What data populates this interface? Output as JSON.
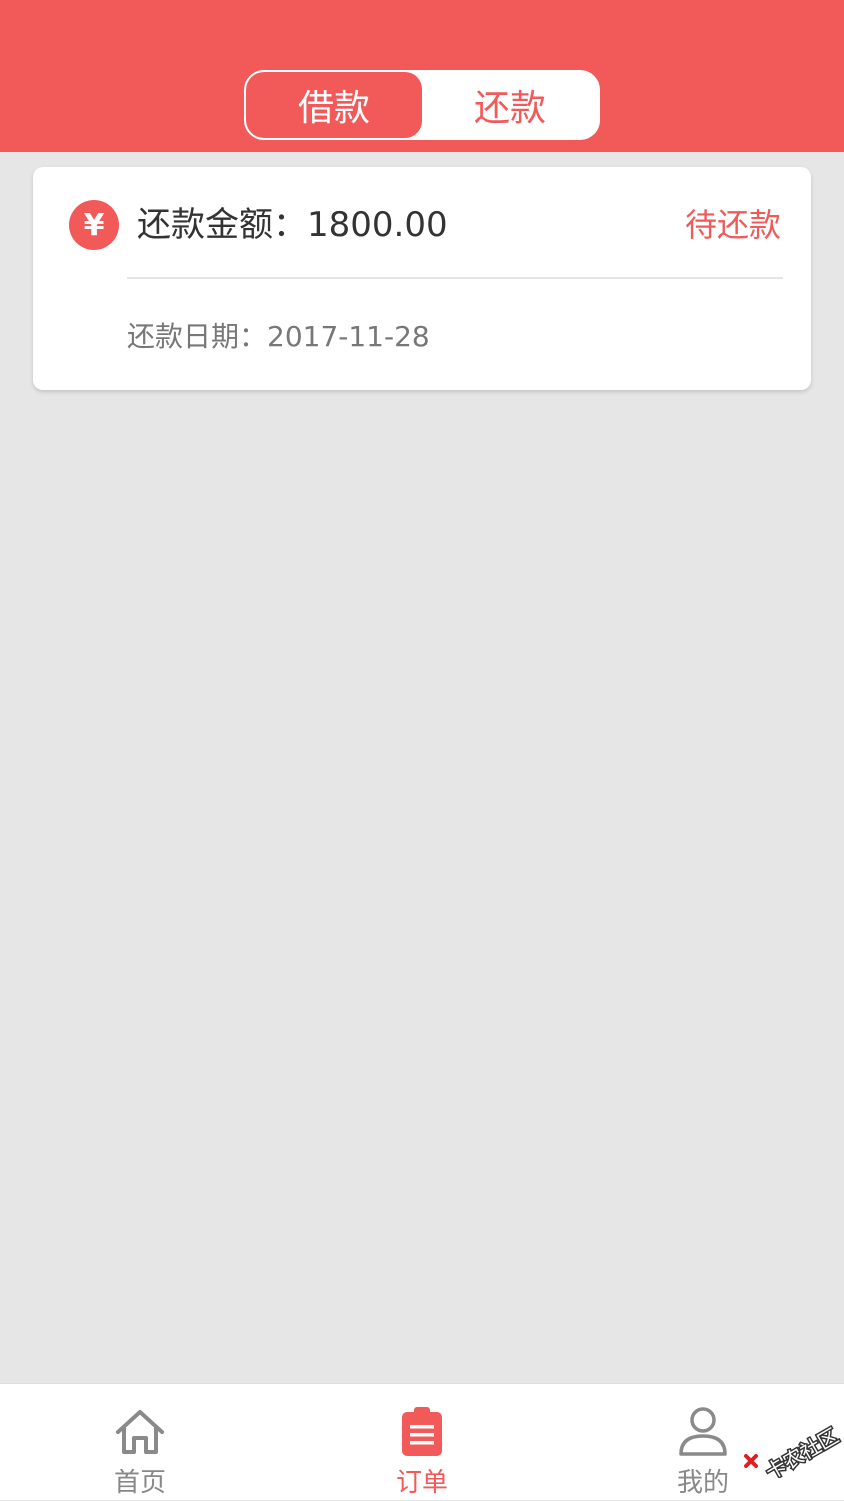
{
  "colors": {
    "brand": "#f25a5a",
    "background": "#e6e6e6"
  },
  "segment": {
    "borrow_label": "借款",
    "repay_label": "还款",
    "selected": "借款"
  },
  "card": {
    "icon": "yen-icon",
    "icon_glyph": "¥",
    "amount_text": "还款金额：1800.00",
    "status_text": "待还款",
    "date_text": "还款日期：2017-11-28"
  },
  "tabbar": {
    "items": [
      {
        "label": "首页",
        "icon": "home-icon",
        "active": false
      },
      {
        "label": "订单",
        "icon": "clipboard-icon",
        "active": true
      },
      {
        "label": "我的",
        "icon": "user-icon",
        "active": false
      }
    ]
  },
  "watermark": {
    "text": "卡农社区"
  }
}
